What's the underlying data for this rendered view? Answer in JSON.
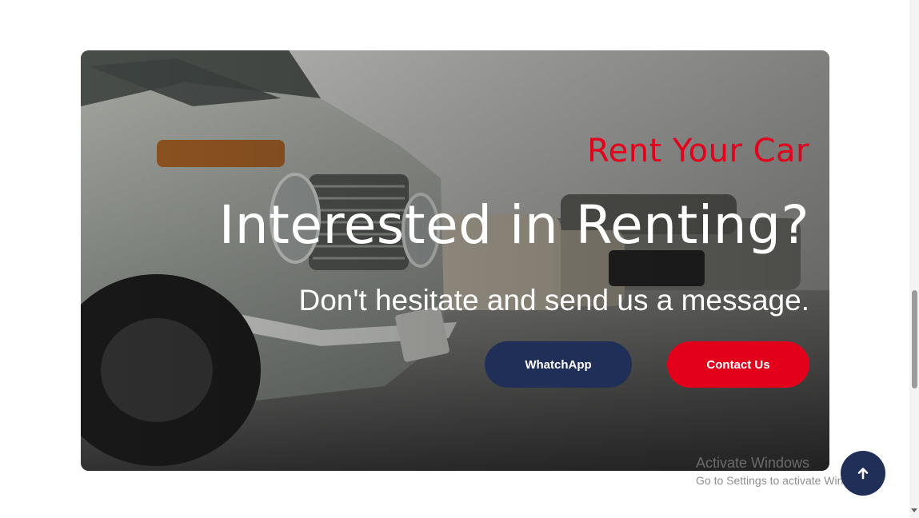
{
  "hero": {
    "eyebrow": "Rent Your Car",
    "headline": "Interested in Renting?",
    "subline": "Don't hesitate and send us a message.",
    "buttons": {
      "whatsapp_label": "WhatchApp",
      "contact_label": "Contact Us"
    },
    "background": "vintage cars parked in a showroom"
  },
  "watermark": {
    "title": "Activate Windows",
    "subtitle": "Go to Settings to activate Windows."
  },
  "scroll_top": {
    "icon": "arrow-up-icon"
  },
  "colors": {
    "accent_red": "#e3001b",
    "navy": "#1f2f57",
    "white": "#ffffff"
  }
}
